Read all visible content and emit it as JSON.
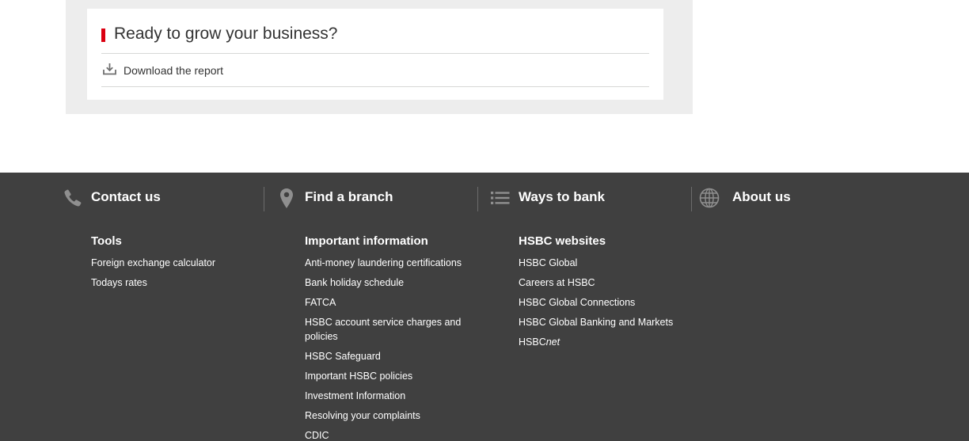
{
  "promo": {
    "title": "Ready to grow your business?",
    "download_label": "Download the report",
    "accent_color": "#db0011"
  },
  "footer": {
    "background_color": "#404040",
    "nav": [
      {
        "label": "Contact us",
        "icon": "phone-icon"
      },
      {
        "label": "Find a branch",
        "icon": "map-pin-icon"
      },
      {
        "label": "Ways to bank",
        "icon": "list-icon"
      },
      {
        "label": "About us",
        "icon": "globe-icon"
      }
    ],
    "tools": {
      "title": "Tools",
      "links": [
        "Foreign exchange calculator",
        "Todays rates"
      ]
    },
    "important": {
      "title": "Important information",
      "links": [
        "Anti-money laundering certifications",
        "Bank holiday schedule",
        "FATCA",
        "HSBC account service charges and policies",
        "HSBC Safeguard",
        "Important HSBC policies",
        "Investment Information",
        "Resolving your complaints",
        "CDIC"
      ]
    },
    "websites": {
      "title": "HSBC websites",
      "links": [
        "HSBC Global",
        "Careers at HSBC",
        "HSBC Global Connections",
        "HSBC Global Banking and Markets"
      ],
      "hsbcnet": {
        "prefix": "HSBC",
        "suffix": "net"
      }
    }
  }
}
